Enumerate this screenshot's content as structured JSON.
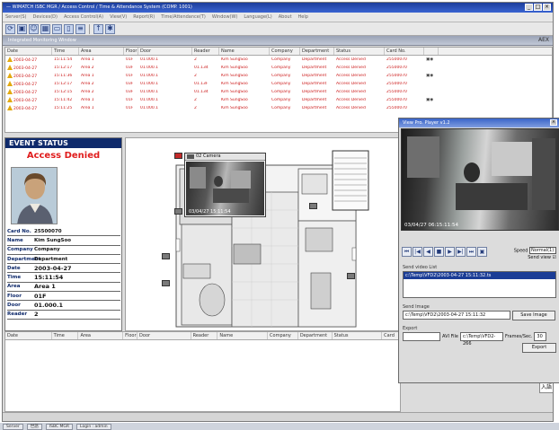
{
  "titlebar": {
    "title": "— WIMATCH ISBC MGR / Access Control / Time & Attendance System (COMP. 1001)"
  },
  "menu": [
    "Server(S)",
    "Devices(D)",
    "Access Control(A)",
    "View(V)",
    "Report(R)",
    "Time/Attendance(T)",
    "Window(W)",
    "Language(L)",
    "About",
    "Help"
  ],
  "monitor_window": {
    "title": "Integrated Monitoring Window",
    "right_label": "AEX"
  },
  "log_columns": [
    "Date",
    "Time",
    "Area",
    "Floor",
    "Door",
    "Reader",
    "Name",
    "Company",
    "Department",
    "Status",
    "Card No.",
    ""
  ],
  "log_rows": [
    {
      "date": "2003-04-27",
      "time": "15:11:54",
      "area": "Area 1",
      "floor": "01F",
      "door": "01.000.1",
      "reader": "2",
      "name": "Kim SungSoo",
      "company": "Company",
      "department": "Department",
      "status": "Access Denied",
      "card": "25500070"
    },
    {
      "date": "2003-04-27",
      "time": "15:12:17",
      "area": "Area 2",
      "floor": "03F",
      "door": "01.000.1",
      "reader": "01.134",
      "name": "Kim SungSoo",
      "company": "Company",
      "department": "Department",
      "status": "Access Denied",
      "card": "25500070"
    },
    {
      "date": "2003-04-27",
      "time": "15:11:36",
      "area": "Area 1",
      "floor": "01F",
      "door": "01.000.1",
      "reader": "2",
      "name": "Kim SungSoo",
      "company": "Company",
      "department": "Department",
      "status": "Access Denied",
      "card": "25500070"
    },
    {
      "date": "2003-04-27",
      "time": "15:12:17",
      "area": "Area 2",
      "floor": "03F",
      "door": "01.000.1",
      "reader": "01.13F",
      "name": "Kim SungSoo",
      "company": "Company",
      "department": "Department",
      "status": "Access Denied",
      "card": "25500070"
    },
    {
      "date": "2003-04-27",
      "time": "15:12:15",
      "area": "Area 2",
      "floor": "03F",
      "door": "01.000.1",
      "reader": "01.134",
      "name": "Kim SungSoo",
      "company": "Company",
      "department": "Department",
      "status": "Access Denied",
      "card": "25500070"
    },
    {
      "date": "2003-04-27",
      "time": "15:11:42",
      "area": "Area 1",
      "floor": "01F",
      "door": "01.000.1",
      "reader": "2",
      "name": "Kim SungSoo",
      "company": "Company",
      "department": "Department",
      "status": "Access Denied",
      "card": "25500070"
    },
    {
      "date": "2003-04-27",
      "time": "15:11:25",
      "area": "Area 1",
      "floor": "01F",
      "door": "01.000.1",
      "reader": "2",
      "name": "Kim SungSoo",
      "company": "Company",
      "department": "Department",
      "status": "Access Denied",
      "card": "25500070"
    }
  ],
  "event": {
    "title": "EVENT STATUS",
    "status": "Access Denied",
    "card_label": "Card No.",
    "card": "25500070",
    "name_label": "Name",
    "name": "Kim SungSoo",
    "company_label": "Company",
    "company": "Company",
    "dept_label": "Department",
    "dept": "Department",
    "date_label": "Date",
    "date": "2003-04-27",
    "time_label": "Time",
    "time": "15:11:54",
    "area_label": "Area",
    "area": "Area 1",
    "floor_label": "Floor",
    "floor": "01F",
    "door_label": "Door",
    "door": "01.000.1",
    "reader_label": "Reader",
    "reader": "2"
  },
  "map_camera": {
    "title": "02 Camera",
    "timestamp": "03/04/27 15:11:54"
  },
  "viewer": {
    "title": "View Pro. Player v1.2",
    "timestamp": "03/04/27 06:15:11:54",
    "speed_label": "Speed",
    "speed_value": "Normal(1)",
    "send_view_label": "Send view",
    "send_list_label": "Send video List",
    "send_list_item": "c:\\Temp\\VFD2\\2003-04-27 15:11:32.ts",
    "send_image_label": "Send Image",
    "send_image_path": "c:\\Temp\\VFD2\\2003-04-27 15:11:32",
    "save_image": "Save Image",
    "export_label": "Export",
    "export_path_label": "AVI File",
    "export_path": "c:\\Temp\\VFD2-266",
    "frames_label": "Frames/Sec.",
    "frames_value": "30",
    "export_button": "Export"
  },
  "log2_columns": [
    "Date",
    "Time",
    "Area",
    "Floor",
    "Door",
    "Reader",
    "Name",
    "Company",
    "Department",
    "Status",
    "Card"
  ],
  "lang_button": "入語",
  "taskbar": [
    "Server",
    "世語",
    "ISBC MGR",
    "Login : admin"
  ]
}
